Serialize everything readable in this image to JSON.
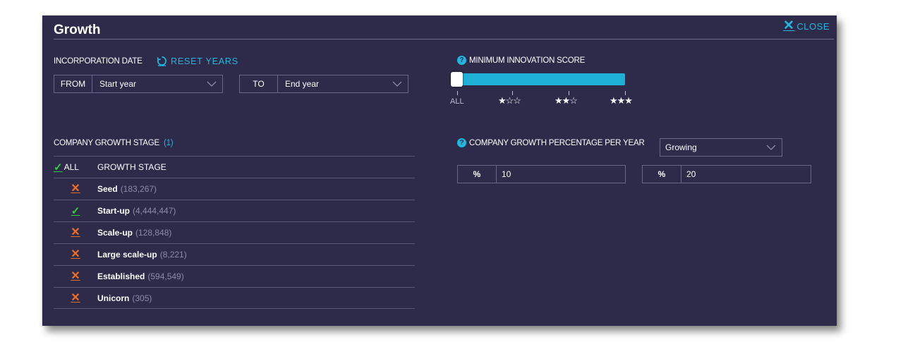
{
  "dialog": {
    "title": "Growth",
    "close_label": "CLOSE"
  },
  "incorporation": {
    "label": "INCORPORATION DATE",
    "reset_label": "RESET YEARS",
    "from_label": "FROM",
    "from_value": "Start year",
    "to_label": "TO",
    "to_value": "End year"
  },
  "growth_stage": {
    "label": "COMPANY GROWTH STAGE",
    "count": "(1)",
    "all_label": "ALL",
    "column_header": "GROWTH STAGE",
    "items": [
      {
        "name": "Seed",
        "count": "(183,267)",
        "selected": false
      },
      {
        "name": "Start-up",
        "count": "(4,444,447)",
        "selected": true
      },
      {
        "name": "Scale-up",
        "count": "(128,848)",
        "selected": false
      },
      {
        "name": "Large scale-up",
        "count": "(8,221)",
        "selected": false
      },
      {
        "name": "Established",
        "count": "(594,549)",
        "selected": false
      },
      {
        "name": "Unicorn",
        "count": "(305)",
        "selected": false
      }
    ]
  },
  "innovation": {
    "label": "MINIMUM INNOVATION SCORE",
    "level": 0,
    "tick_labels": [
      "ALL",
      "★☆☆",
      "★★☆",
      "★★★"
    ]
  },
  "growth_pct": {
    "label": "COMPANY GROWTH PERCENTAGE PER YEAR",
    "select_value": "Growing",
    "min_prefix": "%",
    "min_value": "10",
    "max_prefix": "%",
    "max_value": "20"
  },
  "colors": {
    "panel_bg": "#2e2a4a",
    "accent": "#20b6e0",
    "check": "#30d040",
    "cross": "#f07020"
  }
}
